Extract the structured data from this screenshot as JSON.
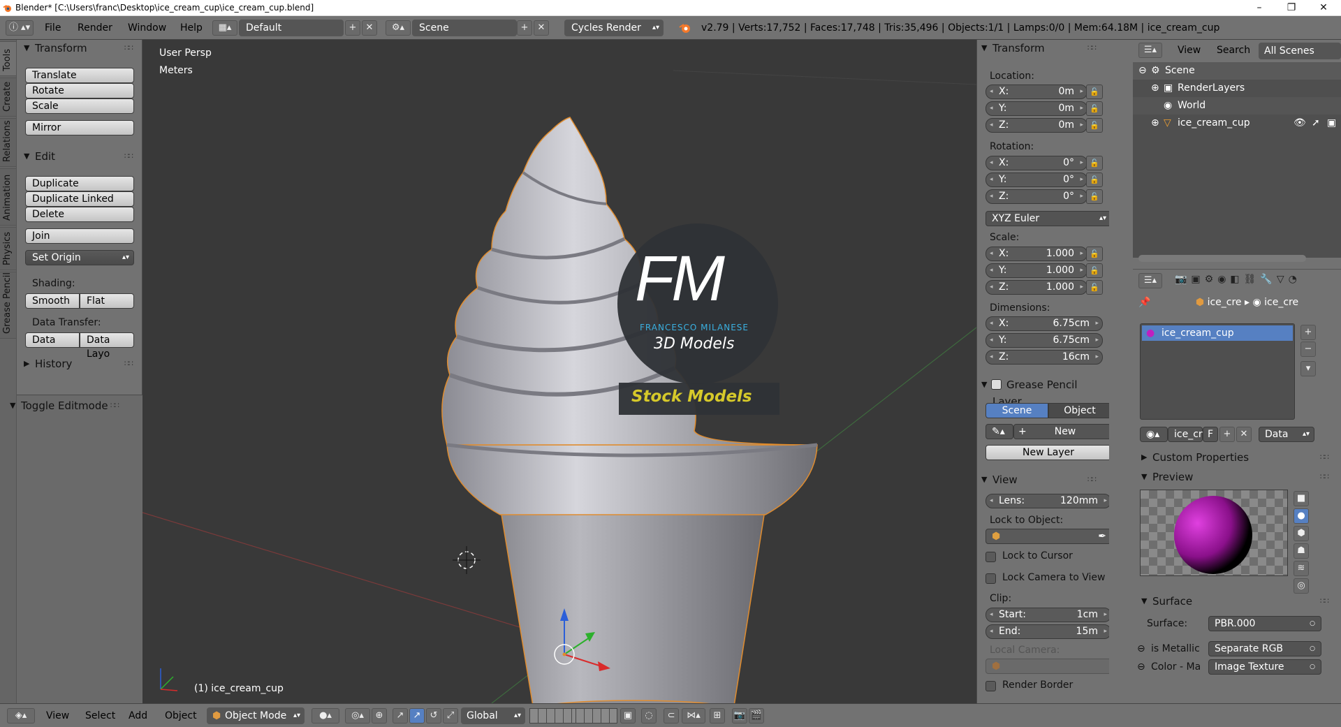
{
  "window": {
    "title": "Blender* [C:\\Users\\franc\\Desktop\\ice_cream_cup\\ice_cream_cup.blend]",
    "minimize": "–",
    "maximize": "❐",
    "close": "✕"
  },
  "topbar": {
    "menus": [
      "File",
      "Render",
      "Window",
      "Help"
    ],
    "layout": "Default",
    "scene": "Scene",
    "engine": "Cycles Render",
    "stats": "v2.79 | Verts:17,752 | Faces:17,748 | Tris:35,496 | Objects:1/1 | Lamps:0/0 | Mem:64.18M | ice_cream_cup"
  },
  "vtabs": [
    "Tools",
    "Create",
    "Relations",
    "Animation",
    "Physics",
    "Grease Pencil"
  ],
  "toolshelf": {
    "transform_title": "Transform",
    "translate": "Translate",
    "rotate": "Rotate",
    "scale": "Scale",
    "mirror": "Mirror",
    "edit_title": "Edit",
    "duplicate": "Duplicate",
    "duplicate_linked": "Duplicate Linked",
    "delete": "Delete",
    "join": "Join",
    "set_origin": "Set Origin",
    "shading_label": "Shading:",
    "smooth": "Smooth",
    "flat": "Flat",
    "data_transfer_label": "Data Transfer:",
    "data": "Data",
    "data_layout": "Data Layo",
    "history": "History",
    "toggle_editmode": "Toggle Editmode"
  },
  "viewport": {
    "view_name": "User Persp",
    "units": "Meters",
    "object_label": "(1) ice_cream_cup",
    "logo_letters": "FM",
    "logo_name": "FRANCESCO MILANESE",
    "logo_sub": "3D Models",
    "logo_banner": "Stock Models"
  },
  "npanel": {
    "transform_title": "Transform",
    "location_label": "Location:",
    "location": [
      {
        "axis": "X:",
        "value": "0m"
      },
      {
        "axis": "Y:",
        "value": "0m"
      },
      {
        "axis": "Z:",
        "value": "0m"
      }
    ],
    "rotation_label": "Rotation:",
    "rotation": [
      {
        "axis": "X:",
        "value": "0°"
      },
      {
        "axis": "Y:",
        "value": "0°"
      },
      {
        "axis": "Z:",
        "value": "0°"
      }
    ],
    "rotation_mode": "XYZ Euler",
    "scale_label": "Scale:",
    "scale": [
      {
        "axis": "X:",
        "value": "1.000"
      },
      {
        "axis": "Y:",
        "value": "1.000"
      },
      {
        "axis": "Z:",
        "value": "1.000"
      }
    ],
    "dimensions_label": "Dimensions:",
    "dimensions": [
      {
        "axis": "X:",
        "value": "6.75cm"
      },
      {
        "axis": "Y:",
        "value": "6.75cm"
      },
      {
        "axis": "Z:",
        "value": "16cm"
      }
    ],
    "grease_title": "Grease Pencil Layer",
    "gp_scene": "Scene",
    "gp_object": "Object",
    "gp_new": "New",
    "gp_new_layer": "New Layer",
    "view_title": "View",
    "lens_label": "Lens:",
    "lens_value": "120mm",
    "lock_to_object": "Lock to Object:",
    "lock_to_cursor": "Lock to Cursor",
    "lock_camera": "Lock Camera to View",
    "clip_label": "Clip:",
    "clip_start_label": "Start:",
    "clip_start": "1cm",
    "clip_end_label": "End:",
    "clip_end": "15m",
    "local_camera": "Local Camera:",
    "render_border": "Render Border"
  },
  "outliner": {
    "menus": [
      "View",
      "Search"
    ],
    "filter": "All Scenes",
    "rows": [
      "Scene",
      "RenderLayers",
      "World",
      "ice_cream_cup"
    ]
  },
  "properties": {
    "breadcrumb_1": "ice_cre",
    "breadcrumb_2": "ice_cre",
    "material_slot": "ice_cream_cup",
    "mat_name": "ice_cr",
    "mat_fake": "F",
    "link": "Data",
    "custom_props": "Custom Properties",
    "preview": "Preview",
    "surface_title": "Surface",
    "surface_label": "Surface:",
    "surface_value": "PBR.000",
    "metallic_label": "is Metallic",
    "metallic_value": "Separate RGB",
    "color_label": "Color - Ma",
    "color_value": "Image Texture"
  },
  "bottombar": {
    "menus": [
      "View",
      "Select",
      "Add",
      "Object"
    ],
    "mode": "Object Mode",
    "orientation": "Global"
  }
}
